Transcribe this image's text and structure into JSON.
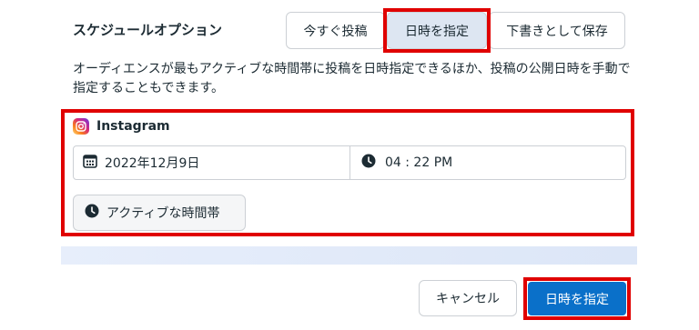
{
  "section": {
    "title": "スケジュールオプション",
    "description": "オーディエンスが最もアクティブな時間帯に投稿を日時指定できるほか、投稿の公開日時を手動で指定することもできます。"
  },
  "segments": {
    "post_now": "今すぐ投稿",
    "schedule": "日時を指定",
    "save_draft": "下書きとして保存",
    "selected": "schedule"
  },
  "panel": {
    "platform": "Instagram",
    "date": "2022年12月9日",
    "time": "04 : 22 PM",
    "active_times_label": "アクティブな時間帯"
  },
  "footer": {
    "cancel_label": "キャンセル",
    "submit_label": "日時を指定"
  },
  "colors": {
    "highlight": "#e00000",
    "primary": "#0a70c9",
    "selected_segment": "#dde6f2"
  }
}
